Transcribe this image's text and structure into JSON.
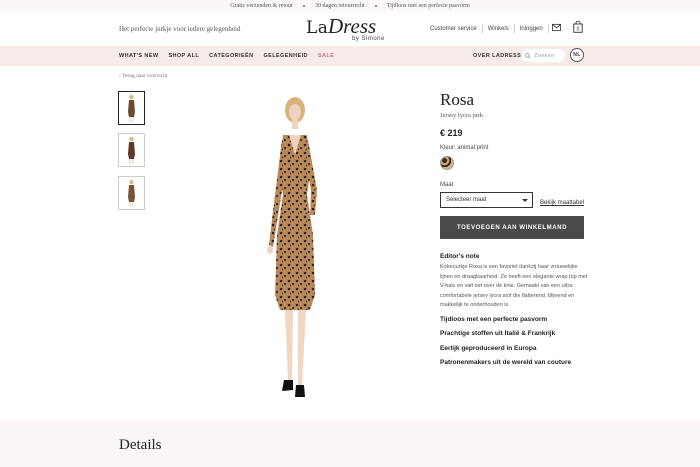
{
  "topbar": {
    "items": [
      "Gratis verzenden & retour",
      "30 dagen retourrecht",
      "Tijdloos met een perfecte pasvorm"
    ]
  },
  "header": {
    "tagline": "Het perfecte jurkje voor iedere gelegenheid",
    "logo": {
      "la": "La",
      "dress": "Dress",
      "by": "by Simone"
    },
    "links": [
      "Customer service",
      "Winkels",
      "Inloggen"
    ],
    "icons": [
      "mail-icon",
      "bag-icon"
    ],
    "cart_count": "0"
  },
  "nav": {
    "items": [
      "WHAT'S NEW",
      "SHOP ALL",
      "CATEGORIEËN",
      "GELEGENHEID",
      "SALE"
    ],
    "about": "OVER LADRESS",
    "search_placeholder": "Zoeken",
    "lang": "NL",
    "sale_color": "#d66b8a"
  },
  "back_link": "Terug naar overzicht",
  "product": {
    "title": "Rosa",
    "subtitle": "Jersey lycra jurk",
    "price": "€ 219",
    "color_label": "Kleur: animal print",
    "size_label": "Maat",
    "size_select": "Selecteer maat",
    "size_guide": "Bekijk maattabel",
    "add_to_cart": "TOEVOEGEN AAN WINKELMAND",
    "editors_note_title": "Editor's note",
    "editors_note": "Kokerjurkje Rosa is een favoriet dankzij haar vrouwelijke lijnen en draagbaarheid. Ze heeft een elegante wrap top met V-hals en valt net over de knie. Gemaakt van een ultra comfortabele jersey lycra stof die flatterend, blijvend en makkelijk te onderhouden is.",
    "features": [
      "Tijdloos met een perfecte pasvorm",
      "Prachtige stoffen uit Italië & Frankrijk",
      "Eerlijk geproduceerd in Europa",
      "Patronenmakers uit de wereld van couture"
    ],
    "button_color": "#4a4a4a"
  },
  "details_title": "Details"
}
